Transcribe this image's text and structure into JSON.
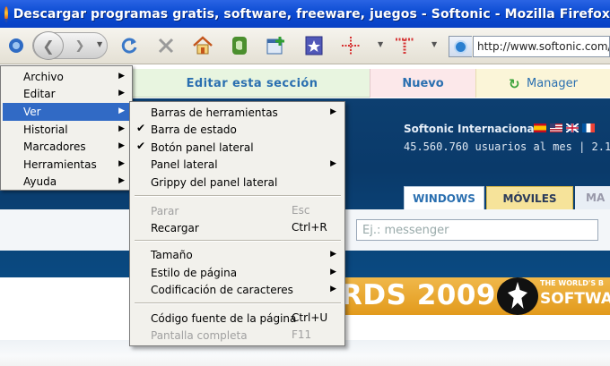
{
  "window": {
    "title": "Descargar programas gratis, software, freeware, juegos - Softonic - Mozilla Firefox"
  },
  "toolbar": {
    "url": "http://www.softonic.com/",
    "icons": [
      "back-icon",
      "forward-icon",
      "reload-icon",
      "stop-icon",
      "home-icon",
      "evernote-icon",
      "add-bookmark-icon",
      "bookmark-star-icon",
      "grid-cross-icon",
      "t-letter-icon",
      "site-identity-icon"
    ]
  },
  "page": {
    "edit_section": "Editar esta sección",
    "nuevo": "Nuevo",
    "manager": "Manager",
    "intl": "Softonic Internacional",
    "users": "45.560.760 usuarios al mes  |  2.1",
    "tabs": [
      "WINDOWS",
      "MÓVILES",
      "MA"
    ],
    "search_placeholder": "Ej.: messenger",
    "awards": "RDS 2009",
    "awards_tag": "THE WORLD'S B",
    "awards_sw": "SOFTWAR"
  },
  "menu": {
    "items": [
      {
        "label": "Archivo"
      },
      {
        "label": "Editar"
      },
      {
        "label": "Ver"
      },
      {
        "label": "Historial"
      },
      {
        "label": "Marcadores"
      },
      {
        "label": "Herramientas"
      },
      {
        "label": "Ayuda"
      }
    ]
  },
  "submenu": {
    "toolbars": "Barras de herramientas",
    "statusbar": "Barra de estado",
    "sidebar_button": "Botón panel lateral",
    "sidebar": "Panel lateral",
    "grippy": "Grippy del panel lateral",
    "stop": "Parar",
    "stop_sc": "Esc",
    "reload": "Recargar",
    "reload_sc": "Ctrl+R",
    "size": "Tamaño",
    "page_style": "Estilo de página",
    "encoding": "Codificación de caracteres",
    "source": "Código fuente de la página",
    "source_sc": "Ctrl+U",
    "fullscreen": "Pantalla completa",
    "fullscreen_sc": "F11"
  },
  "colors": {
    "titlebar": "#0a4ad1",
    "menu_highlight": "#316ac5",
    "banner": "#0a3a6a",
    "awards": "#e29a1c"
  }
}
